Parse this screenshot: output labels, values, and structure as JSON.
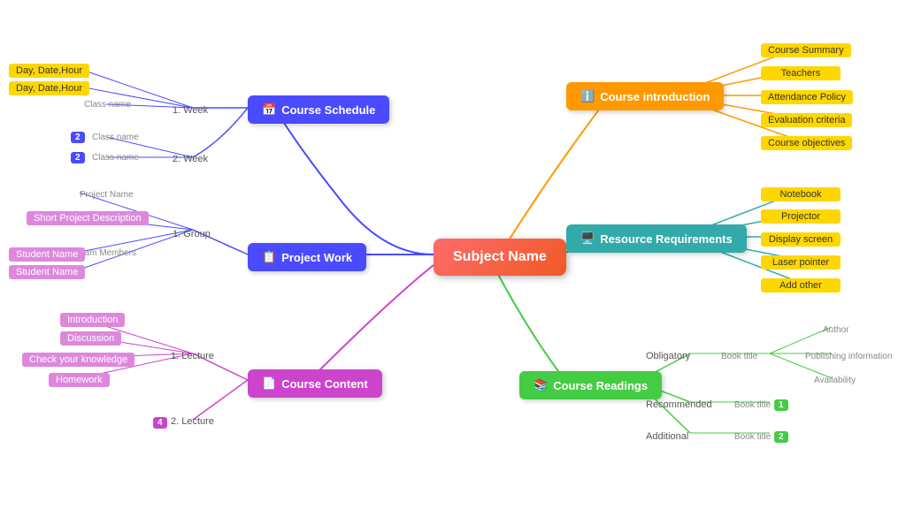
{
  "main": {
    "label": "Subject Name"
  },
  "branches": {
    "courseSchedule": {
      "label": "Course Schedule",
      "icon": "📅"
    },
    "projectWork": {
      "label": "Project Work",
      "icon": "📋"
    },
    "courseContent": {
      "label": "Course Content",
      "icon": "📄"
    },
    "courseIntro": {
      "label": "Course introduction",
      "icon": "ℹ️"
    },
    "resourceReq": {
      "label": "Resource Requirements",
      "icon": "🖥️"
    },
    "courseReadings": {
      "label": "Course Readings",
      "icon": "📚"
    }
  },
  "scheduleLeaves": {
    "week1": "1. Week",
    "week2": "2. Week",
    "day1": "Day, Date,Hour",
    "day2": "Day, Date,Hour",
    "class1": "Class name",
    "class2": "Class name",
    "class3": "Class name"
  },
  "projectLeaves": {
    "group1": "1. Group",
    "projectName": "Project Name",
    "shortDesc": "Short Project Description",
    "teamMembers": "Team Members",
    "student1": "Student Name",
    "student2": "Student Name"
  },
  "contentLeaves": {
    "lec1": "1. Lecture",
    "lec2": "2. Lecture",
    "intro": "Introduction",
    "discussion": "Discussion",
    "check": "Check your knowledge",
    "homework": "Homework"
  },
  "introLeaves": [
    "Course Summary",
    "Teachers",
    "Attendance Policy",
    "Evaluation criteria",
    "Course objectives"
  ],
  "resourceLeaves": [
    "Notebook",
    "Projector",
    "Display screen",
    "Laser pointer",
    "Add other"
  ],
  "readingsLeaves": {
    "obligatory": "Obligatory",
    "recommended": "Recommended",
    "additional": "Additional",
    "bookTitle": "Book title",
    "author": "Author",
    "pubInfo": "Publishing information",
    "availability": "Availability"
  }
}
